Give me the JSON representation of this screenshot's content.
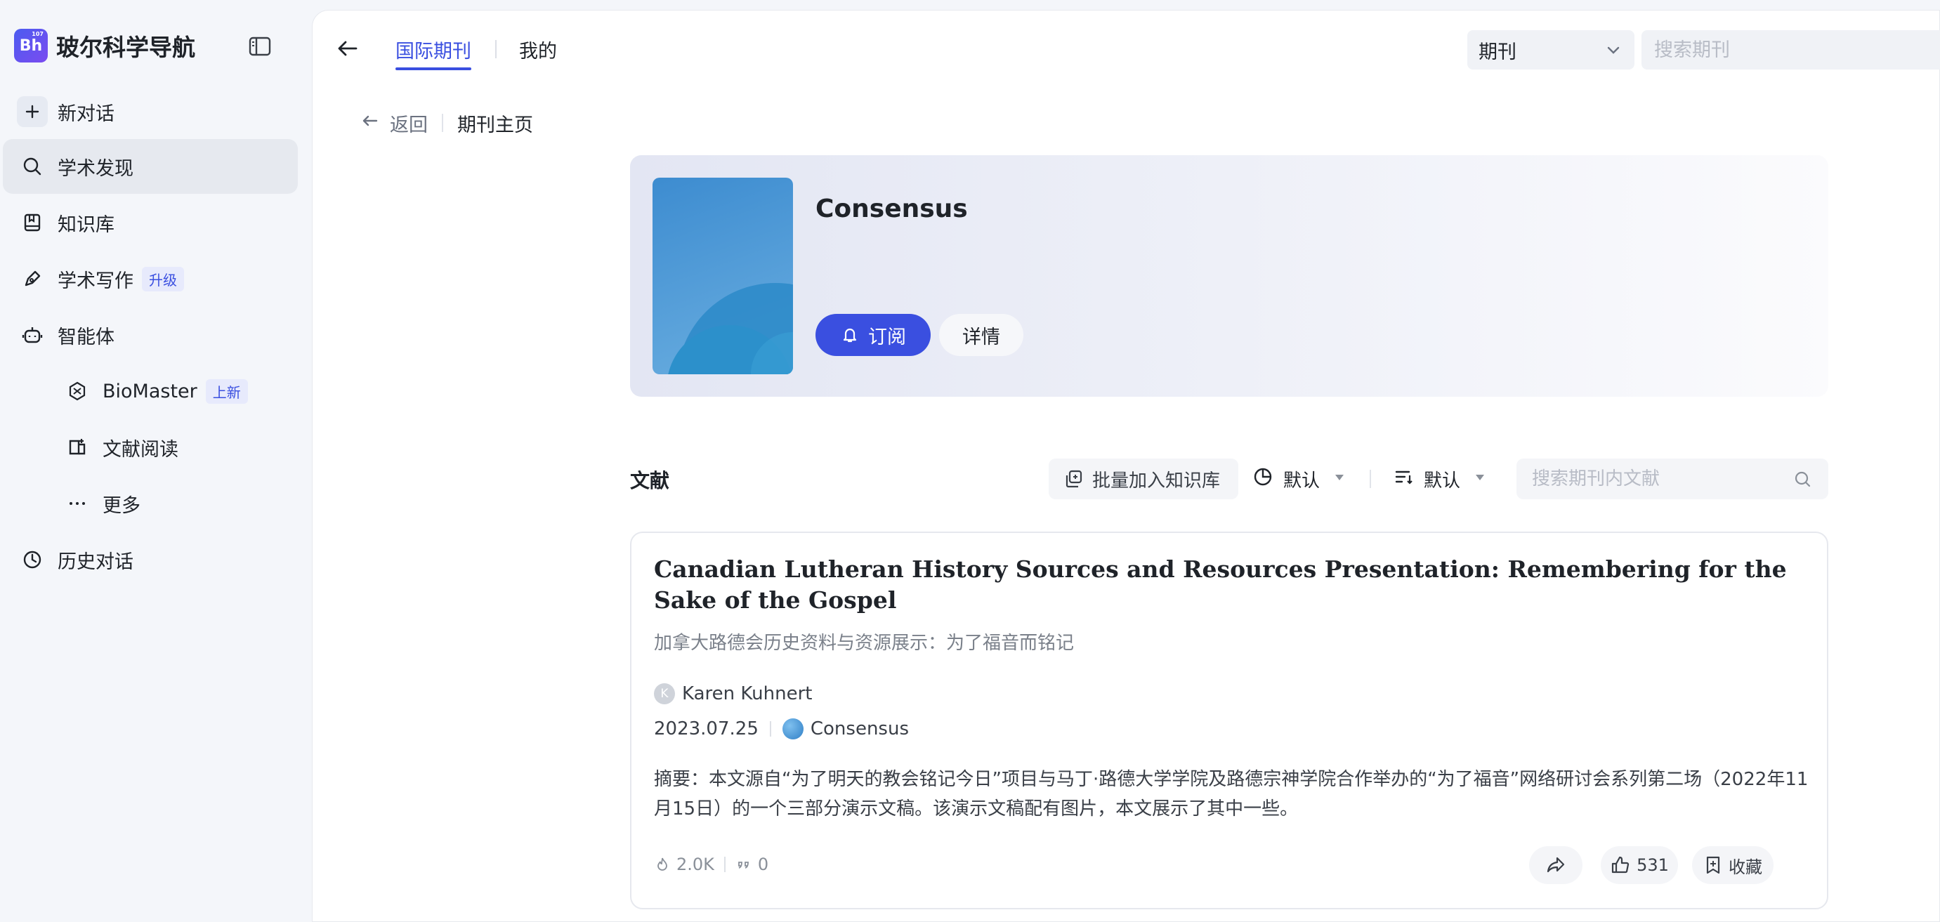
{
  "brand": {
    "logo_text": "Bh",
    "logo_small": "107",
    "title": "玻尔科学导航"
  },
  "sidebar": {
    "items": [
      {
        "label": "新对话"
      },
      {
        "label": "学术发现"
      },
      {
        "label": "知识库"
      },
      {
        "label": "学术写作",
        "badge": "升级"
      },
      {
        "label": "智能体"
      },
      {
        "label": "BioMaster",
        "badge": "上新"
      },
      {
        "label": "文献阅读"
      },
      {
        "label": "更多"
      },
      {
        "label": "历史对话"
      }
    ]
  },
  "topbar": {
    "tabs": [
      {
        "label": "国际期刊"
      },
      {
        "label": "我的"
      }
    ],
    "select_value": "期刊",
    "search_placeholder": "搜索期刊"
  },
  "breadcrumb": {
    "back": "返回",
    "current": "期刊主页"
  },
  "journal": {
    "name": "Consensus",
    "subscribe_label": "订阅",
    "detail_label": "详情"
  },
  "literature": {
    "title": "文献",
    "batch_label": "批量加入知识库",
    "sort1_label": "默认",
    "sort2_label": "默认",
    "search_placeholder": "搜索期刊内文献"
  },
  "article": {
    "title": "Canadian Lutheran History Sources and Resources Presentation: Remembering for the Sake of the Gospel",
    "subtitle": "加拿大路德会历史资料与资源展示：为了福音而铭记",
    "author_initial": "K",
    "author": "Karen Kuhnert",
    "date": "2023.07.25",
    "journal": "Consensus",
    "abstract": "摘要：本文源自“为了明天的教会铭记今日”项目与马丁·路德大学学院及路德宗神学院合作举办的“为了福音”网络研讨会系列第二场（2022年11月15日）的一个三部分演示文稿。该演示文稿配有图片，本文展示了其中一些。",
    "views": "2.0K",
    "citations": "0",
    "likes": "531",
    "favorite_label": "收藏"
  },
  "colors": {
    "accent": "#3a4fe0",
    "badge_bg": "#e7eafc"
  }
}
